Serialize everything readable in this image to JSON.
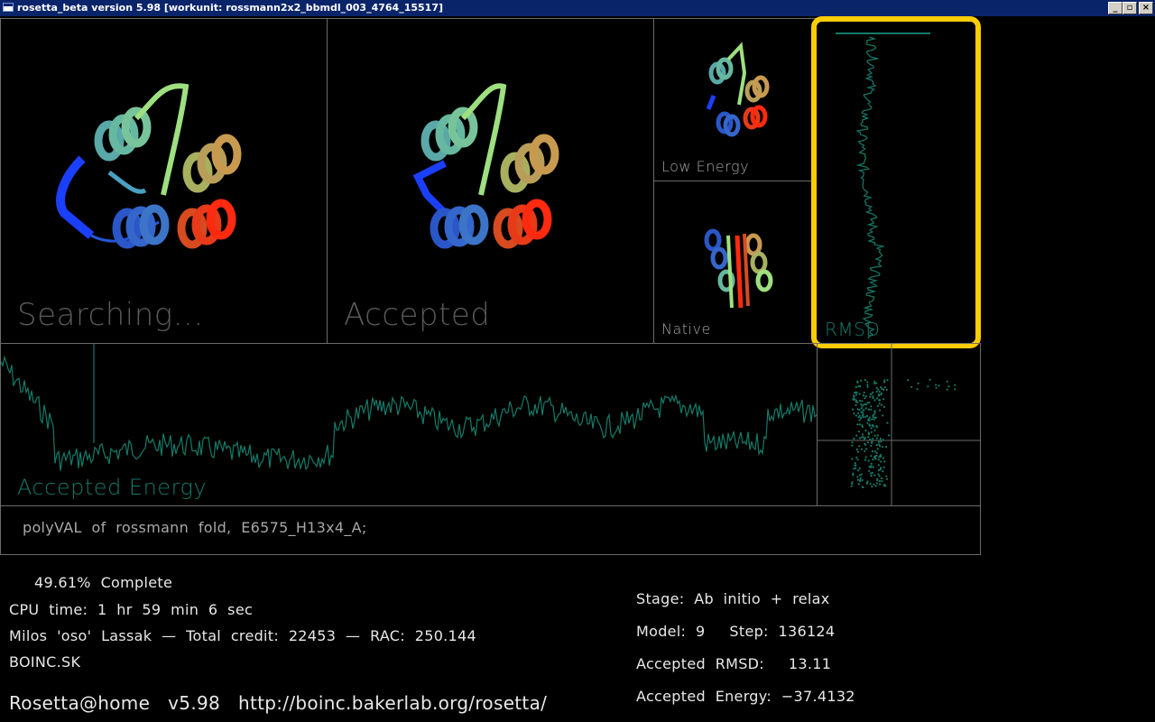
{
  "window": {
    "title": "rosetta_beta version 5.98 [workunit: rossmann2x2_bbmdl_003_4764_15517]",
    "minimize": "_",
    "restore": "▫",
    "close": "×"
  },
  "panels": {
    "searching_label": "Searching...",
    "accepted_label": "Accepted",
    "low_energy_label": "Low  Energy",
    "native_label": "Native",
    "rmsd_label": "RMSD",
    "accepted_energy_label": "Accepted  Energy"
  },
  "description": "polyVAL  of  rossmann  fold,  E6575_H13x4_A;",
  "status": {
    "complete": "49.61%  Complete",
    "cpu_time": "CPU  time:  1  hr  59  min  6  sec",
    "user_line": "Milos  'oso'  Lassak  —  Total  credit:  22453  —  RAC:  250.144",
    "team": "BOINC.SK",
    "footer": "Rosetta@home   v5.98   http://boinc.bakerlab.org/rosetta/"
  },
  "run_info": {
    "stage": "Stage:  Ab  initio  +  relax",
    "model_step": "Model:  9     Step:  136124",
    "accepted_rmsd": "Accepted  RMSD:     13.11",
    "accepted_energy": "Accepted  Energy:  −37.4132"
  },
  "colors": {
    "trace": "#157a68",
    "highlight": "#ffcc00",
    "border": "#6b6b6b"
  }
}
